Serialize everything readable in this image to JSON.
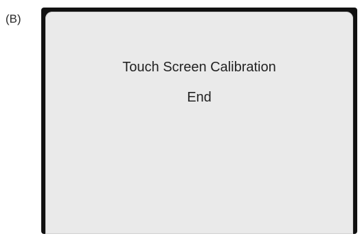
{
  "figure_label": "(B)",
  "screen": {
    "title": "Touch Screen Calibration",
    "status": "End"
  }
}
